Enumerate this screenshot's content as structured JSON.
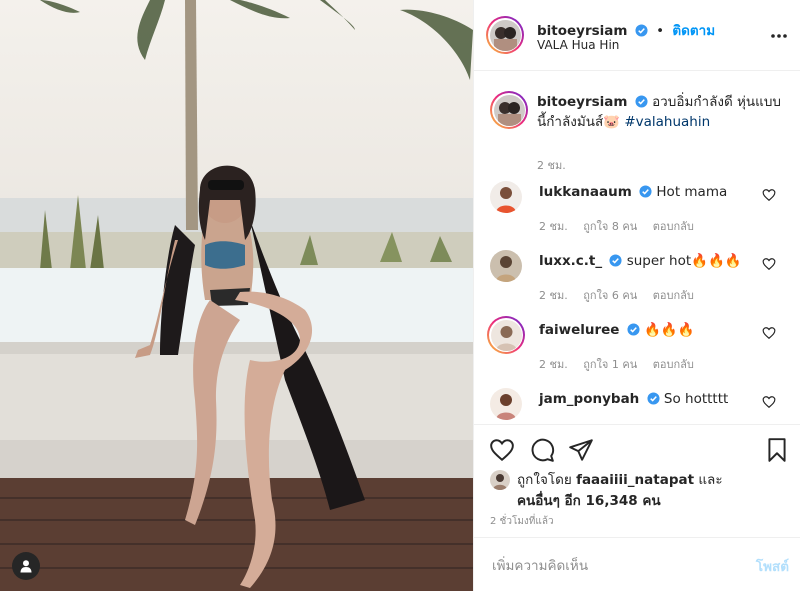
{
  "post": {
    "author": "bitoeyrsiam",
    "follow_label": "ติดตาม",
    "dot": "•",
    "location": "VALA Hua Hin",
    "more_icon": "more-horizontal-icon"
  },
  "caption": {
    "username": "bitoeyrsiam",
    "text": "อวบอิ่มกำลังดี หุ่นแบบนี้กำลังมันส์🐷",
    "hashtag": "#valahuahin",
    "time": "2 ชม."
  },
  "comments": [
    {
      "username": "lukkanaaum",
      "text": "Hot mama",
      "time": "2 ชม.",
      "likes": "ถูกใจ 8 คน",
      "reply": "ตอบกลับ"
    },
    {
      "username": "luxx.c.t_",
      "text": "super hot🔥🔥🔥",
      "time": "2 ชม.",
      "likes": "ถูกใจ 6 คน",
      "reply": "ตอบกลับ"
    },
    {
      "username": "faiwelurее",
      "text": "🔥🔥🔥",
      "time": "2 ชม.",
      "likes": "ถูกใจ 1 คน",
      "reply": "ตอบกลับ"
    },
    {
      "username": "jam_ponybah",
      "text": "So hottttt"
    }
  ],
  "likes": {
    "prefix": "ถูกใจโดย",
    "first_user": "faaaiiii_natapat",
    "and": "และ",
    "others": "คนอื่นๆ อีก 16,348 คน"
  },
  "posted_ago": "2 ชั่วโมงที่แล้ว",
  "add_comment": {
    "placeholder": "เพิ่มความคิดเห็น",
    "post_label": "โพสต์"
  },
  "colors": {
    "accent": "#0095f6",
    "verified": "#3897f0",
    "post_disabled": "#b2dffc",
    "text": "#262626",
    "muted": "#8e8e8e"
  }
}
